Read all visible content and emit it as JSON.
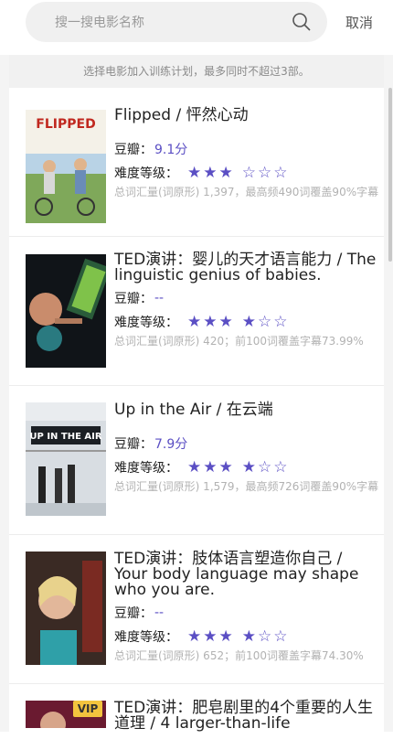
{
  "search": {
    "placeholder": "搜一搜电影名称",
    "cancel_label": "取消"
  },
  "notice": "选择电影加入训练计划，最多同时不超过3部。",
  "labels": {
    "douban": "豆瓣：",
    "difficulty": "难度等级："
  },
  "colors": {
    "accent": "#5b4fc4",
    "meta": "#b2b2b2",
    "vip": "#f3c43e"
  },
  "movies": [
    {
      "title": "Flipped / 怦然心动",
      "douban_score": "9.1分",
      "difficulty_filled": 3,
      "difficulty_max": 6,
      "stats": "总词汇量(词原形) 1,397，最高频490词覆盖90%字幕",
      "poster_text": "FLIPPED"
    },
    {
      "title": "TED演讲：婴儿的天才语言能力 / The linguistic genius of babies.",
      "douban_score": "--",
      "difficulty_filled": 4,
      "difficulty_max": 6,
      "stats": "总词汇量(词原形) 420；前100词覆盖字幕73.99%",
      "poster_text": ""
    },
    {
      "title": "Up in the Air / 在云端",
      "douban_score": "7.9分",
      "difficulty_filled": 4,
      "difficulty_max": 6,
      "stats": "总词汇量(词原形) 1,579，最高频726词覆盖90%字幕",
      "poster_text": "UP IN THE AIR"
    },
    {
      "title": "TED演讲：肢体语言塑造你自己 / Your body language may shape who you are.",
      "douban_score": "--",
      "difficulty_filled": 4,
      "difficulty_max": 6,
      "stats": "总词汇量(词原形) 652；前100词覆盖字幕74.30%",
      "poster_text": ""
    },
    {
      "title": "TED演讲：肥皂剧里的4个重要的人生道理 / 4 larger-than-life",
      "badge": "VIP"
    }
  ]
}
